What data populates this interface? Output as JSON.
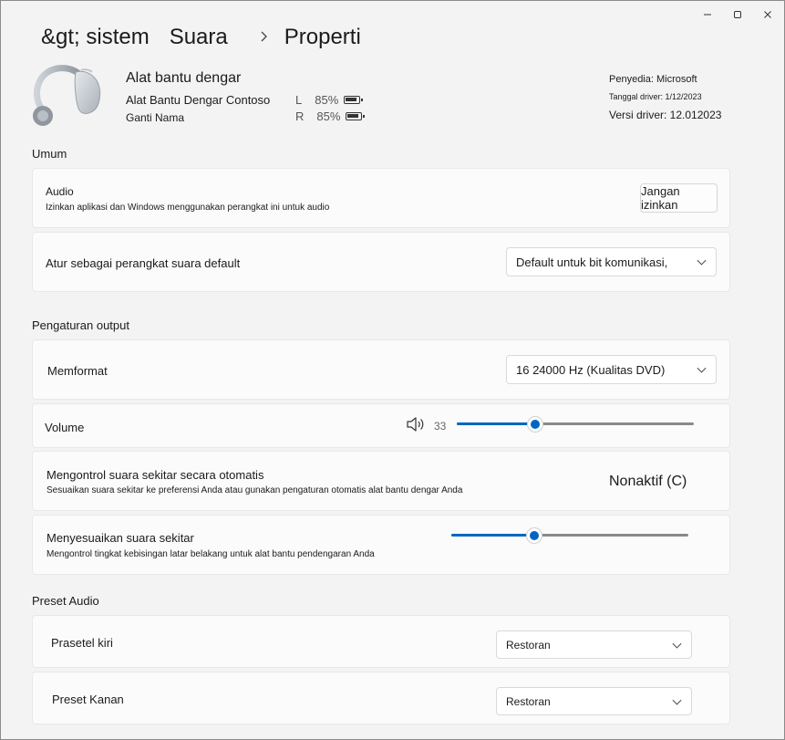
{
  "window": {
    "minimize_icon": "minimize-icon",
    "maximize_icon": "maximize-icon",
    "close_icon": "close-icon"
  },
  "breadcrumb": {
    "items": [
      "&gt; sistem",
      "Suara",
      "Properti"
    ],
    "separator_icon": "chevron-right-icon"
  },
  "device": {
    "image_icon": "hearing-aid-icon",
    "title": "Alat bantu dengar",
    "model": "Alat Bantu Dengar Contoso",
    "rename_link": "Ganti Nama",
    "battery": {
      "left": {
        "side": "L",
        "percent_label": "85%",
        "level": 0.85
      },
      "right": {
        "side": "R",
        "percent_label": "85%",
        "level": 0.85
      }
    },
    "provider": "Penyedia: Microsoft",
    "driver_date": "Tanggal driver: 1/12/2023",
    "driver_version": "Versi driver: 12.012023"
  },
  "general": {
    "section_title": "Umum",
    "audio": {
      "title": "Audio",
      "subtitle": "Izinkan aplikasi dan Windows menggunakan perangkat ini untuk audio",
      "button_label": "Jangan izinkan"
    },
    "default_device": {
      "title": "Atur sebagai perangkat suara default",
      "selected": "Default untuk bit komunikasi,"
    }
  },
  "output": {
    "section_title": "Pengaturan output",
    "format": {
      "title": "Memformat",
      "selected": "16 24000 Hz (Kualitas DVD)"
    },
    "volume": {
      "title": "Volume",
      "icon": "speaker-volume-icon",
      "value_label": "33",
      "value": 33,
      "max": 100
    },
    "ambient_auto": {
      "title": "Mengontrol suara sekitar secara otomatis",
      "subtitle": "Sesuaikan suara sekitar ke preferensi Anda atau gunakan pengaturan otomatis alat bantu dengar Anda",
      "state_label": "Nonaktif (C)"
    },
    "ambient_adjust": {
      "title": "Menyesuaikan suara sekitar",
      "subtitle": "Mengontrol tingkat kebisingan latar belakang untuk alat bantu pendengaran Anda",
      "value": 0.35
    }
  },
  "presets": {
    "section_title": "Preset Audio",
    "left": {
      "title": "Prasetel kiri",
      "selected": "Restoran"
    },
    "right": {
      "title": "Preset Kanan",
      "selected": "Restoran"
    }
  },
  "colors": {
    "accent": "#0067c0",
    "background": "#f3f3f3",
    "card": "#fbfbfb"
  }
}
